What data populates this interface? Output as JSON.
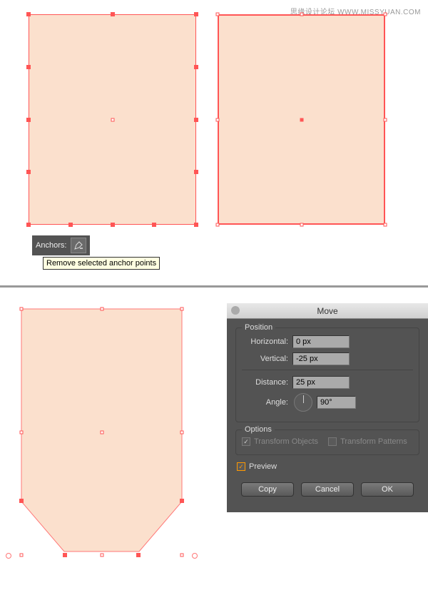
{
  "watermark": "思缘设计论坛  WWW.MISSYUAN.COM",
  "anchors_bar": {
    "label": "Anchors:"
  },
  "tooltip": "Remove selected anchor points",
  "move_dialog": {
    "title": "Move",
    "position_group": "Position",
    "horizontal_label": "Horizontal:",
    "horizontal_value": "0 px",
    "vertical_label": "Vertical:",
    "vertical_value": "-25 px",
    "distance_label": "Distance:",
    "distance_value": "25 px",
    "angle_label": "Angle:",
    "angle_value": "90°",
    "options_group": "Options",
    "transform_objects": "Transform Objects",
    "transform_patterns": "Transform Patterns",
    "preview": "Preview",
    "copy": "Copy",
    "cancel": "Cancel",
    "ok": "OK"
  }
}
